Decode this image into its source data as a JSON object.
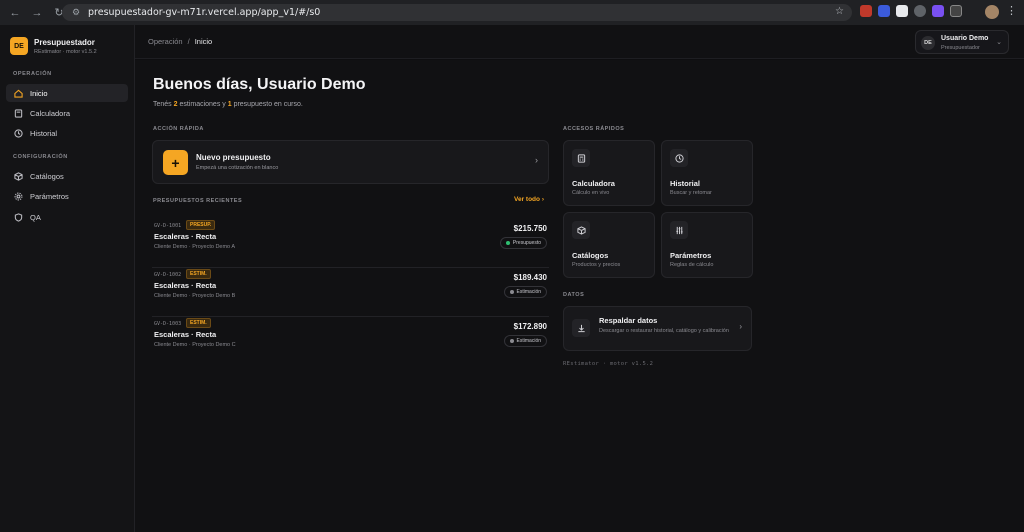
{
  "browser": {
    "url": "presupuestador-gv-m71r.vercel.app/app_v1/#/s0"
  },
  "brand": {
    "logo": "DE",
    "title": "Presupuestador",
    "subtitle": "REstimator · motor v1.5.2"
  },
  "sidebar": {
    "section_operacion": "OPERACIÓN",
    "section_config": "CONFIGURACIÓN",
    "items": [
      {
        "label": "Inicio",
        "icon": "home-icon"
      },
      {
        "label": "Calculadora",
        "icon": "calculator-icon"
      },
      {
        "label": "Historial",
        "icon": "clock-icon"
      },
      {
        "label": "Catálogos",
        "icon": "box-icon"
      },
      {
        "label": "Parámetros",
        "icon": "sliders-icon"
      },
      {
        "label": "QA",
        "icon": "shield-icon"
      }
    ]
  },
  "topbar": {
    "crumb_parent": "Operación",
    "crumb_sep": "/",
    "crumb_current": "Inicio",
    "user_initials": "DE",
    "user_name": "Usuario Demo",
    "user_role": "Presupuestador"
  },
  "main": {
    "greeting": "Buenos días, Usuario Demo",
    "sub_pre": "Tenés ",
    "sub_n1": "2",
    "sub_mid": " estimaciones y ",
    "sub_n2": "1",
    "sub_post": " presupuesto en curso.",
    "quick_label": "ACCIÓN RÁPIDA",
    "quick_title": "Nuevo presupuesto",
    "quick_sub": "Empezá una cotización en blanco",
    "recent_label": "PRESUPUESTOS RECIENTES",
    "see_all": "Ver todo",
    "rows": [
      {
        "code": "GV-D-1001",
        "badge": "PRESUP.",
        "title": "Escaleras · Recta",
        "sub": "Cliente Demo · Proyecto Demo A",
        "amount": "$215.750",
        "status": "Presupuesto",
        "status_color": "#2fbf71"
      },
      {
        "code": "GV-D-1002",
        "badge": "ESTIM.",
        "title": "Escaleras · Recta",
        "sub": "Cliente Demo · Proyecto Demo B",
        "amount": "$189.430",
        "status": "Estimación",
        "status_color": "#8a8a90"
      },
      {
        "code": "GV-D-1003",
        "badge": "ESTIM.",
        "title": "Escaleras · Recta",
        "sub": "Cliente Demo · Proyecto Demo C",
        "amount": "$172.890",
        "status": "Estimación",
        "status_color": "#8a8a90"
      }
    ],
    "access_label": "ACCESOS RÁPIDOS",
    "tiles": [
      {
        "title": "Calculadora",
        "sub": "Cálculo en vivo",
        "icon": "calculator-icon"
      },
      {
        "title": "Historial",
        "sub": "Buscar y retomar",
        "icon": "clock-icon"
      },
      {
        "title": "Catálogos",
        "sub": "Productos y precios",
        "icon": "box-icon"
      },
      {
        "title": "Parámetros",
        "sub": "Reglas de cálculo",
        "icon": "sliders-icon"
      }
    ],
    "data_label": "DATOS",
    "backup_title": "Respaldar datos",
    "backup_sub": "Descargar o restaurar historial, catálogo y calibración",
    "version": "REstimator · motor v1.5.2"
  },
  "colors": {
    "accent": "#f5a623",
    "background": "#111113"
  }
}
